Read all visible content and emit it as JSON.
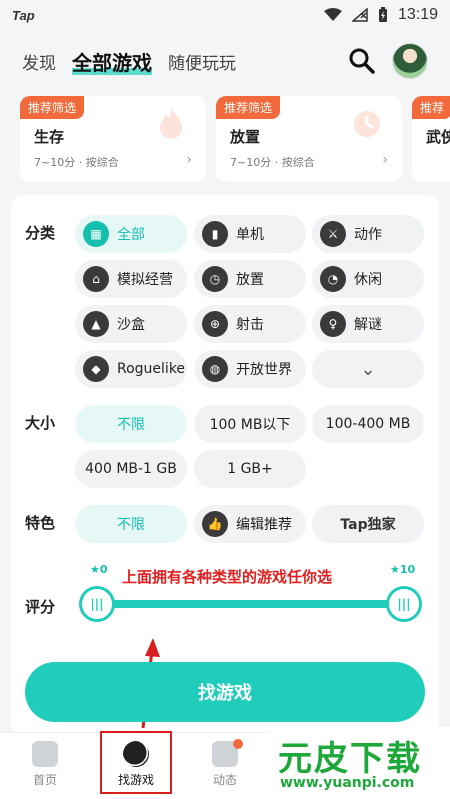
{
  "status_bar": {
    "app_logo": "Tap",
    "time": "13:19"
  },
  "top_nav": {
    "tabs": [
      "发现",
      "全部游戏",
      "随便玩玩"
    ],
    "active_index": 1
  },
  "cards": [
    {
      "tag": "推荐筛选",
      "name": "生存",
      "meta": "7~10分 · 按综合",
      "arrow": "›"
    },
    {
      "tag": "推荐筛选",
      "name": "放置",
      "meta": "7~10分 · 按综合",
      "arrow": "›"
    },
    {
      "tag": "推荐",
      "name": "武侠",
      "meta": "",
      "arrow": ""
    }
  ],
  "filters": {
    "category_label": "分类",
    "categories": [
      "全部",
      "单机",
      "动作",
      "模拟经营",
      "放置",
      "休闲",
      "沙盒",
      "射击",
      "解谜",
      "Roguelike",
      "开放世界"
    ],
    "expand_symbol": "⌄",
    "size_label": "大小",
    "sizes": [
      "不限",
      "100 MB以下",
      "100-400 MB",
      "400 MB-1 GB",
      "1 GB+"
    ],
    "feature_label": "特色",
    "features": [
      "不限",
      "编辑推荐",
      "Tap独家"
    ],
    "rating_label": "评分",
    "rating_min_label": "★0",
    "rating_max_label": "★10",
    "rating_range": [
      0,
      10
    ],
    "knob_glyph": "|||",
    "annotation": "上面拥有各种类型的游戏任你选"
  },
  "find_button": "找游戏",
  "bottom_nav": {
    "items": [
      "首页",
      "找游戏",
      "动态"
    ],
    "active_index": 1
  },
  "watermark": {
    "title": "元皮下载",
    "url": "www.yuanpi.com"
  },
  "colors": {
    "accent": "#20cdbb",
    "tag": "#f26a3b",
    "annotation": "#e02020"
  }
}
